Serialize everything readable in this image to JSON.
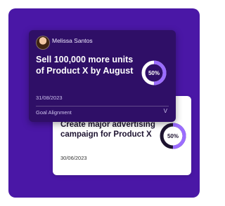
{
  "cards": {
    "back": {
      "title": "Create major advertising campaign for Product X",
      "date": "30/06/2023",
      "progress": 0.5,
      "progress_label": "50%"
    },
    "front": {
      "owner_name": "Melissa Santos",
      "title": "Sell 100,000 more units of Product X by August",
      "date": "31/08/2023",
      "progress": 0.5,
      "progress_label": "50%",
      "alignment_label": "Goal Alignment",
      "toggle_glyph": "V"
    }
  },
  "colors": {
    "panel_bg": "#4a17a6",
    "card_front_bg": "#2f0f67",
    "ring_progress": "#9b6cff",
    "ring_track_dark": "#ffffff",
    "ring_track_light": "#1d1330"
  }
}
